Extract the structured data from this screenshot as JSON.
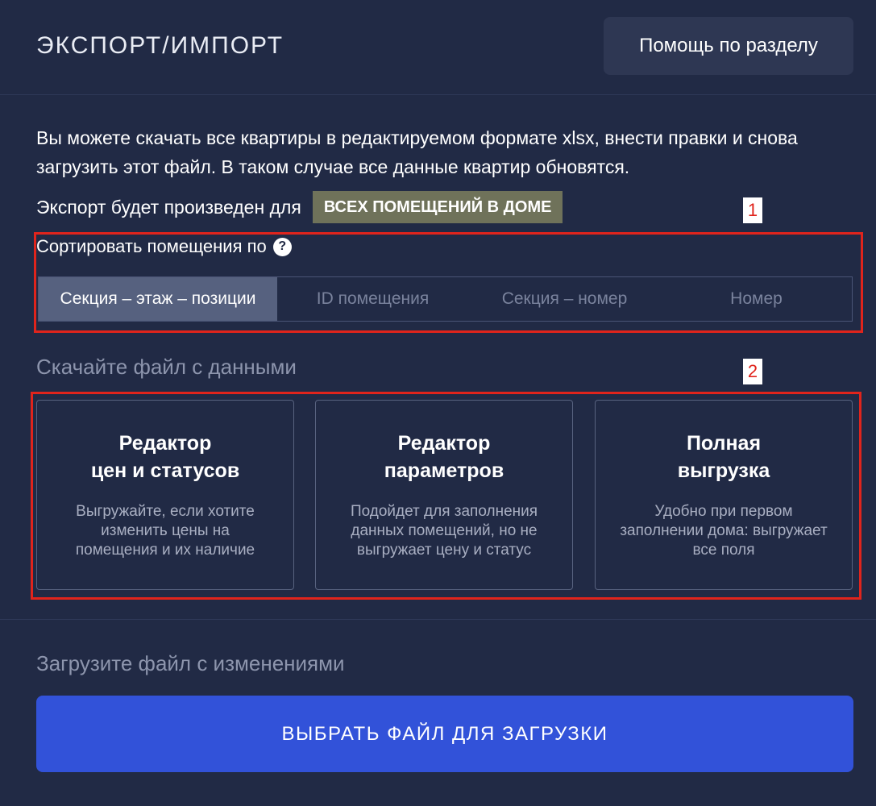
{
  "header": {
    "title": "ЭКСПОРТ/ИМПОРТ",
    "help_button": "Помощь по разделу"
  },
  "intro": {
    "text": "Вы можете скачать все квартиры в редактируемом формате xlsx, внести правки и снова загрузить этот файл. В таком случае все данные квартир обновятся."
  },
  "export": {
    "label": "Экспорт будет произведен для",
    "scope_badge": "ВСЕХ ПОМЕЩЕНИЙ В ДОМЕ"
  },
  "annotations": {
    "marker_1": "1",
    "marker_2": "2",
    "color": "#e0241c"
  },
  "sort": {
    "label": "Сортировать помещения по",
    "help_icon": "?",
    "options": [
      {
        "label": "Секция – этаж – позиции",
        "active": true
      },
      {
        "label": "ID помещения",
        "active": false
      },
      {
        "label": "Секция – номер",
        "active": false
      },
      {
        "label": "Номер",
        "active": false
      }
    ]
  },
  "download": {
    "title": "Скачайте файл с данными",
    "cards": [
      {
        "title_line1": "Редактор",
        "title_line2": "цен и статусов",
        "description": "Выгружайте, если хотите изменить цены на помещения и их наличие"
      },
      {
        "title_line1": "Редактор",
        "title_line2": "параметров",
        "description": "Подойдет для заполнения данных помещений, но не выгружает цену и статус"
      },
      {
        "title_line1": "Полная",
        "title_line2": "выгрузка",
        "description": "Удобно при первом заполнении дома: выгружает все поля"
      }
    ]
  },
  "upload": {
    "title": "Загрузите файл с изменениями",
    "button": "ВЫБРАТЬ ФАЙЛ ДЛЯ ЗАГРУЗКИ"
  },
  "colors": {
    "background": "#212a45",
    "badge": "#6f725a",
    "active_segment": "#56617f",
    "primary_button": "#3252d9"
  }
}
